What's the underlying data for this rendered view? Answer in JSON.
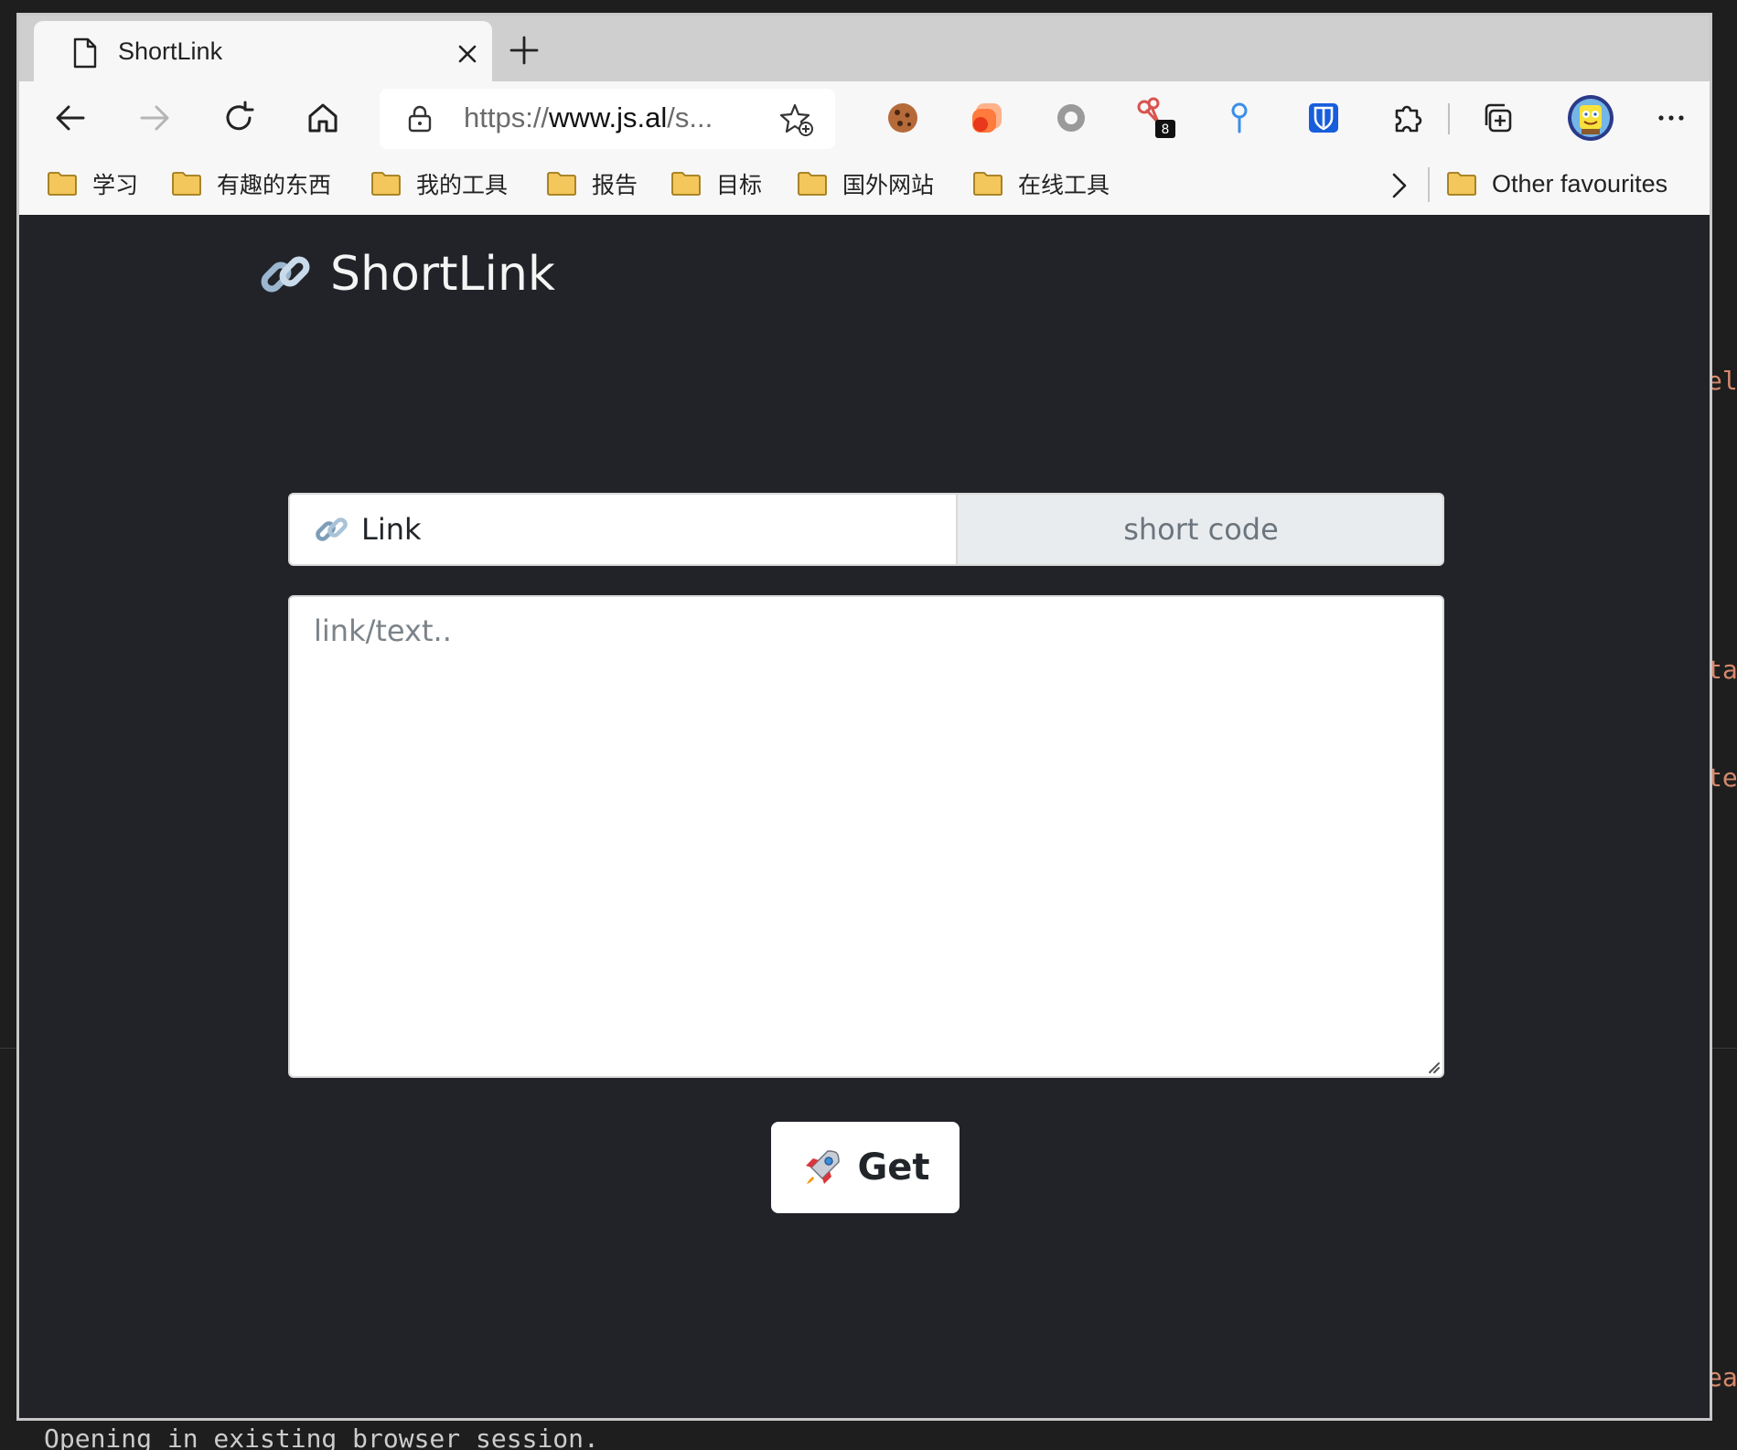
{
  "browser": {
    "tab": {
      "title": "ShortLink"
    },
    "address": {
      "scheme": "https://",
      "host": "www.js.al",
      "rest": "/s..."
    },
    "toolbar": {
      "buttons": [
        "back",
        "forward",
        "refresh",
        "home"
      ],
      "extensions": [
        "cookie-icon",
        "orange-extension-icon",
        "circle-extension-icon",
        "scissors-extension-icon",
        "pin-extension-icon",
        "bitwarden-icon",
        "puzzle-icon",
        "collections-icon",
        "profile-avatar",
        "more-icon"
      ],
      "extension_badge": "8"
    },
    "bookmarks": [
      "学习",
      "有趣的东西",
      "我的工具",
      "报告",
      "目标",
      "国外网站",
      "在线工具"
    ],
    "other_favourites": "Other favourites"
  },
  "page": {
    "brand": "ShortLink",
    "mode_tabs": {
      "link": "Link",
      "short_code": "short code"
    },
    "input": {
      "placeholder": "link/text..",
      "value": ""
    },
    "submit": "Get"
  },
  "terminal": {
    "bottom_line": "Opening in existing browser session.",
    "side_fragments": [
      "el",
      "ta",
      "te",
      "ea"
    ]
  },
  "colors": {
    "page_bg": "#212328",
    "tabstrip": "#cfcfcf",
    "folder": "#f3c75b",
    "bitwarden": "#175ddc"
  }
}
